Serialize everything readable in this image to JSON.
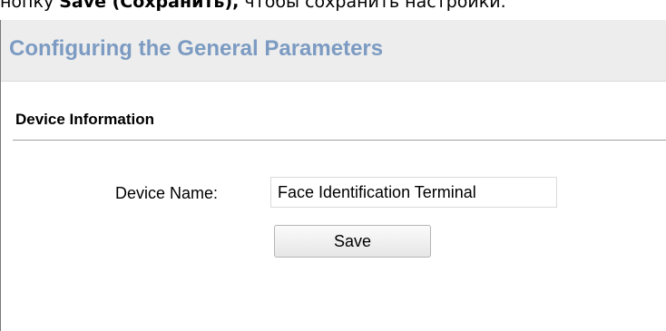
{
  "document": {
    "caption_prefix": "нопку ",
    "caption_bold": "Save (Сохранить),",
    "caption_suffix": " чтобы сохранить настройки."
  },
  "panel": {
    "title": "Configuring the General Parameters",
    "section_title": "Device Information"
  },
  "form": {
    "device_name_label": "Device Name:",
    "device_name_value": "Face Identification Terminal",
    "save_label": "Save"
  },
  "colors": {
    "title_color": "#7c9bc2",
    "header_bg": "#ededed"
  }
}
